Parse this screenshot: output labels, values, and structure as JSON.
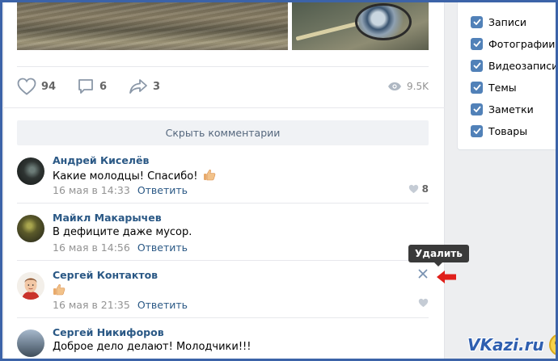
{
  "post": {
    "stats": {
      "likes": "94",
      "comments": "6",
      "shares": "3",
      "views": "9.5K"
    },
    "hide_comments_label": "Скрыть комментарии"
  },
  "comments": [
    {
      "author": "Андрей Киселёв",
      "text": "Какие молодцы! Спасибо!",
      "date": "16 мая в 14:33",
      "reply_label": "Ответить",
      "likes": "8"
    },
    {
      "author": "Майкл Макарычев",
      "text": "В дефиците даже мусор.",
      "date": "16 мая в 14:56",
      "reply_label": "Ответить",
      "likes": ""
    },
    {
      "author": "Сергей Контактов",
      "text": "",
      "date": "16 мая в 21:35",
      "reply_label": "Ответить",
      "likes": ""
    },
    {
      "author": "Сергей Никифоров",
      "text": "Доброе дело делают! Молодчики!!!",
      "date": "",
      "reply_label": "",
      "likes": ""
    }
  ],
  "tooltip": {
    "delete_label": "Удалить"
  },
  "filters": {
    "items": [
      {
        "label": "Записи",
        "checked": true
      },
      {
        "label": "Фотографии",
        "checked": true
      },
      {
        "label": "Видеозаписи",
        "checked": true
      },
      {
        "label": "Темы",
        "checked": true
      },
      {
        "label": "Заметки",
        "checked": true
      },
      {
        "label": "Товары",
        "checked": true
      }
    ]
  },
  "watermark": {
    "text": "VKazi.ru"
  },
  "colors": {
    "link": "#2a5885",
    "accent": "#5181b8",
    "arrow": "#e0201b",
    "frame": "#3c63a8"
  },
  "icons": [
    "heart-icon",
    "comment-icon",
    "share-icon",
    "eye-icon",
    "thumbs-up-icon",
    "close-icon",
    "red-arrow-icon",
    "checkbox-icon"
  ]
}
